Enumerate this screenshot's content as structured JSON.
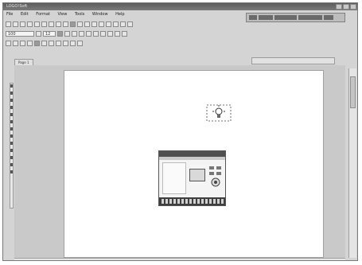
{
  "window": {
    "title": "LOGO!Soft"
  },
  "menu": [
    "File",
    "Edit",
    "Format",
    "View",
    "Tools",
    "Window",
    "Help"
  ],
  "toolbar": {
    "zoom_value": "100",
    "font_size": "12"
  },
  "tabs": [
    {
      "label": "Page 1"
    }
  ],
  "icons": {
    "window_controls": [
      "minimize-icon",
      "maximize-icon",
      "close-icon"
    ],
    "toolbar_buttons": [
      "new-icon",
      "open-icon",
      "save-icon",
      "print-icon",
      "cut-icon",
      "copy-icon",
      "paste-icon",
      "undo-icon",
      "redo-icon",
      "zoom-icon"
    ],
    "left_tools": [
      "select-icon",
      "connector-icon",
      "input-icon",
      "output-icon",
      "text-icon",
      "block-icon",
      "function-icon"
    ]
  },
  "canvas": {
    "objects": [
      {
        "type": "lamp",
        "icon": "lightbulb-icon"
      },
      {
        "type": "plc-module",
        "icon": "plc-device-icon"
      }
    ]
  }
}
